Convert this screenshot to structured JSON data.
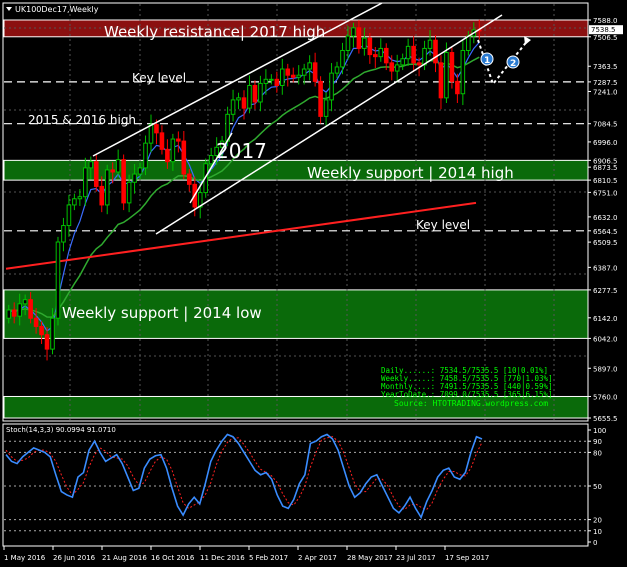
{
  "window": {
    "title": "UK100Dec17,Weekly"
  },
  "colors": {
    "bull": "#00c000",
    "bear": "#ff0000",
    "candle_body_dark": "#000000",
    "resistance_zone": "#8b1010",
    "support_zone": "#0a6a0a",
    "ema_fast": "#3a6cff",
    "ema_mid": "#2faa2f",
    "sma_slow": "#ff2020",
    "stoch_main": "#3a8cff",
    "stoch_signal": "#ff2020",
    "zone_text": "#ffffff",
    "info_text": "#00ff00"
  },
  "annotations": {
    "resistance": "Weekly resistance| 2017 high",
    "support_high": "Weekly support | 2014 high",
    "support_low": "Weekly support | 2014 low",
    "key_level_top": "Key level",
    "key_level_bottom": "Key level",
    "prev_high": "2015 & 2016  high",
    "year": "2017",
    "marker1": "1",
    "marker2": "2"
  },
  "info_box": {
    "daily": "Daily......: 7534.5/7535.5 [10|0.01%]",
    "weekly": "Weekly.....: 7458.5/7535.5 [770|1.03%]",
    "monthly": "Monthly....: 7491.5/7535.5 [440|0.59%]",
    "yeartodate": "YearToDate.: 7099.0/7535.5 [365|6.15%]",
    "source": "Source: HTOTRADING.wordpress.com"
  },
  "stoch_label": "Stoch(14,3,3) 90.0994 91.0710",
  "chart_data": {
    "type": "candlestick",
    "title": "UK100Dec17,Weekly",
    "ylim": [
      5580,
      7620
    ],
    "y_ticks": [
      7588.0,
      7506.5,
      7363.5,
      7287.5,
      7241.0,
      7084.5,
      6996.0,
      6906.5,
      6873.5,
      6810.5,
      6751.0,
      6632.0,
      6564.5,
      6509.5,
      6387.0,
      6277.5,
      6142.0,
      6042.0,
      5897.0,
      5760.0,
      5655.5
    ],
    "price_labels": {
      "last": 7538.5,
      "ask": 7535.5,
      "bid": 7534.5
    },
    "x_ticks": [
      "1 May 2016",
      "26 Jun 2016",
      "21 Aug 2016",
      "16 Oct 2016",
      "11 Dec 2016",
      "5 Feb 2017",
      "2 Apr 2017",
      "28 May 2017",
      "23 Jul 2017",
      "17 Sep 2017"
    ],
    "zones": [
      {
        "name": "Weekly resistance| 2017 high",
        "from": 7506.5,
        "to": 7588.0
      },
      {
        "name": "Weekly support | 2014 high",
        "from": 6810.5,
        "to": 6906.5
      },
      {
        "name": "Weekly support | 2014 low",
        "from": 6042.0,
        "to": 6277.5
      },
      {
        "name": "",
        "from": 5655.5,
        "to": 5760.0
      }
    ],
    "key_levels": [
      7287.5,
      7084.5,
      6564.5
    ],
    "closes": [
      6180,
      6150,
      6210,
      6230,
      6140,
      6100,
      6060,
      5990,
      6140,
      6510,
      6590,
      6690,
      6720,
      6730,
      6870,
      6900,
      6780,
      6690,
      6860,
      6850,
      6910,
      6700,
      6800,
      6840,
      6870,
      6990,
      7080,
      7040,
      6960,
      6900,
      7010,
      7000,
      6840,
      6790,
      6680,
      6750,
      6890,
      6930,
      6970,
      7000,
      7130,
      7200,
      7210,
      7160,
      7270,
      7190,
      7280,
      7300,
      7300,
      7270,
      7350,
      7320,
      7310,
      7320,
      7350,
      7380,
      7290,
      7120,
      7200,
      7330,
      7360,
      7440,
      7510,
      7550,
      7450,
      7500,
      7420,
      7410,
      7450,
      7380,
      7340,
      7370,
      7400,
      7460,
      7380,
      7370,
      7450,
      7490,
      7380,
      7210,
      7430,
      7290,
      7230,
      7440,
      7510,
      7540,
      7538
    ],
    "stochastic": {
      "levels": [
        100,
        90,
        80,
        50,
        20,
        10,
        0
      ],
      "main": [
        78,
        72,
        70,
        76,
        80,
        84,
        82,
        80,
        76,
        60,
        45,
        42,
        40,
        58,
        62,
        82,
        90,
        80,
        72,
        75,
        78,
        70,
        58,
        46,
        48,
        66,
        74,
        77,
        78,
        66,
        48,
        32,
        24,
        34,
        40,
        34,
        52,
        72,
        82,
        90,
        96,
        94,
        88,
        80,
        72,
        64,
        60,
        62,
        56,
        42,
        32,
        30,
        38,
        52,
        60,
        88,
        90,
        94,
        96,
        92,
        82,
        66,
        50,
        40,
        44,
        52,
        58,
        60,
        50,
        40,
        30,
        26,
        32,
        40,
        30,
        22,
        36,
        46,
        58,
        64,
        66,
        58,
        56,
        62,
        80,
        94,
        92
      ],
      "signal": [
        82,
        76,
        72,
        73,
        75,
        80,
        82,
        82,
        79,
        72,
        60,
        49,
        42,
        47,
        53,
        67,
        78,
        84,
        81,
        76,
        75,
        74,
        68,
        58,
        51,
        53,
        63,
        72,
        76,
        74,
        64,
        49,
        35,
        30,
        33,
        36,
        42,
        53,
        69,
        81,
        89,
        93,
        93,
        87,
        80,
        72,
        65,
        62,
        59,
        53,
        43,
        35,
        33,
        40,
        50,
        67,
        80,
        91,
        93,
        94,
        90,
        80,
        66,
        52,
        45,
        45,
        51,
        57,
        56,
        50,
        40,
        32,
        29,
        33,
        34,
        31,
        29,
        35,
        47,
        56,
        63,
        63,
        60,
        59,
        66,
        79,
        89
      ]
    },
    "grid": true
  }
}
